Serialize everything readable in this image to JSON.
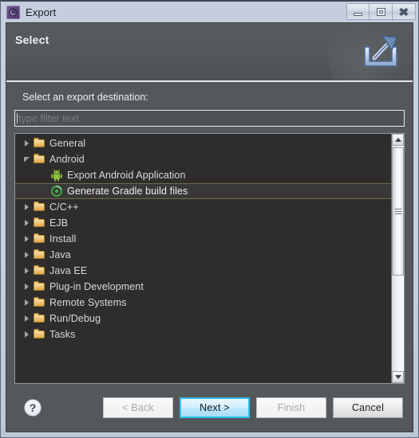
{
  "window": {
    "title": "Export",
    "icon": "eclipse-gear-icon",
    "controls": [
      {
        "name": "minimize",
        "glyph": "minimize-icon"
      },
      {
        "name": "maximize",
        "glyph": "maximize-icon"
      },
      {
        "name": "close",
        "glyph": "close-icon"
      }
    ]
  },
  "banner": {
    "title": "Select",
    "icon": "export-arrow-icon"
  },
  "body": {
    "prompt": "Select an export destination:",
    "filter": {
      "value": "",
      "placeholder": "type filter text"
    }
  },
  "tree": {
    "items": [
      {
        "label": "General",
        "icon": "folder-icon",
        "twisty": "collapsed",
        "depth": 0,
        "selected": false
      },
      {
        "label": "Android",
        "icon": "folder-icon",
        "twisty": "expanded",
        "depth": 0,
        "selected": false
      },
      {
        "label": "Export Android Application",
        "icon": "android-icon",
        "twisty": "none",
        "depth": 1,
        "selected": false
      },
      {
        "label": "Generate Gradle build files",
        "icon": "gradle-icon",
        "twisty": "none",
        "depth": 1,
        "selected": true
      },
      {
        "label": "C/C++",
        "icon": "folder-icon",
        "twisty": "collapsed",
        "depth": 0,
        "selected": false
      },
      {
        "label": "EJB",
        "icon": "folder-icon",
        "twisty": "collapsed",
        "depth": 0,
        "selected": false
      },
      {
        "label": "Install",
        "icon": "folder-icon",
        "twisty": "collapsed",
        "depth": 0,
        "selected": false
      },
      {
        "label": "Java",
        "icon": "folder-icon",
        "twisty": "collapsed",
        "depth": 0,
        "selected": false
      },
      {
        "label": "Java EE",
        "icon": "folder-icon",
        "twisty": "collapsed",
        "depth": 0,
        "selected": false
      },
      {
        "label": "Plug-in Development",
        "icon": "folder-icon",
        "twisty": "collapsed",
        "depth": 0,
        "selected": false
      },
      {
        "label": "Remote Systems",
        "icon": "folder-icon",
        "twisty": "collapsed",
        "depth": 0,
        "selected": false
      },
      {
        "label": "Run/Debug",
        "icon": "folder-icon",
        "twisty": "collapsed",
        "depth": 0,
        "selected": false
      },
      {
        "label": "Tasks",
        "icon": "folder-icon",
        "twisty": "collapsed",
        "depth": 0,
        "selected": false
      }
    ],
    "scrollbar": {
      "position": "near-top",
      "thumb_fraction": 0.57
    }
  },
  "footer": {
    "help": "?",
    "buttons": [
      {
        "label": "< Back",
        "state": "disabled"
      },
      {
        "label": "Next >",
        "state": "default-focused"
      },
      {
        "label": "Finish",
        "state": "disabled"
      },
      {
        "label": "Cancel",
        "state": "enabled"
      }
    ]
  },
  "colors": {
    "dialog_bg": "#55585a",
    "tree_bg": "#2f2d2b",
    "titlebar_bg": "#c9d2de",
    "accent_focus": "#2ec0f5",
    "selection_border": "#6e6a52",
    "folder_yellow": "#ecc271",
    "android_green": "#90c53f"
  }
}
